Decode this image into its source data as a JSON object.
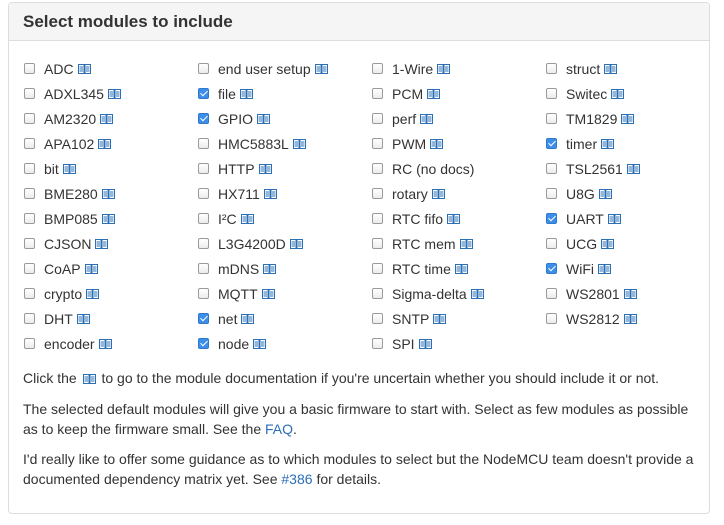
{
  "panel": {
    "title": "Select modules to include"
  },
  "icons": {
    "doc": "book-icon"
  },
  "modules": [
    {
      "name": "ADC",
      "checked": false
    },
    {
      "name": "ADXL345",
      "checked": false
    },
    {
      "name": "AM2320",
      "checked": false
    },
    {
      "name": "APA102",
      "checked": false
    },
    {
      "name": "bit",
      "checked": false
    },
    {
      "name": "BME280",
      "checked": false
    },
    {
      "name": "BMP085",
      "checked": false
    },
    {
      "name": "CJSON",
      "checked": false
    },
    {
      "name": "CoAP",
      "checked": false
    },
    {
      "name": "crypto",
      "checked": false
    },
    {
      "name": "DHT",
      "checked": false
    },
    {
      "name": "encoder",
      "checked": false
    },
    {
      "name": "end user setup",
      "checked": false
    },
    {
      "name": "file",
      "checked": true
    },
    {
      "name": "GPIO",
      "checked": true
    },
    {
      "name": "HMC5883L",
      "checked": false
    },
    {
      "name": "HTTP",
      "checked": false
    },
    {
      "name": "HX711",
      "checked": false
    },
    {
      "name": "I²C",
      "checked": false
    },
    {
      "name": "L3G4200D",
      "checked": false
    },
    {
      "name": "mDNS",
      "checked": false
    },
    {
      "name": "MQTT",
      "checked": false
    },
    {
      "name": "net",
      "checked": true
    },
    {
      "name": "node",
      "checked": true
    },
    {
      "name": "1-Wire",
      "checked": false
    },
    {
      "name": "PCM",
      "checked": false
    },
    {
      "name": "perf",
      "checked": false
    },
    {
      "name": "PWM",
      "checked": false
    },
    {
      "name": "RC (no docs)",
      "checked": false,
      "nodoc": true
    },
    {
      "name": "rotary",
      "checked": false
    },
    {
      "name": "RTC fifo",
      "checked": false
    },
    {
      "name": "RTC mem",
      "checked": false
    },
    {
      "name": "RTC time",
      "checked": false
    },
    {
      "name": "Sigma-delta",
      "checked": false
    },
    {
      "name": "SNTP",
      "checked": false
    },
    {
      "name": "SPI",
      "checked": false
    },
    {
      "name": "struct",
      "checked": false
    },
    {
      "name": "Switec",
      "checked": false
    },
    {
      "name": "TM1829",
      "checked": false
    },
    {
      "name": "timer",
      "checked": true
    },
    {
      "name": "TSL2561",
      "checked": false
    },
    {
      "name": "U8G",
      "checked": false
    },
    {
      "name": "UART",
      "checked": true
    },
    {
      "name": "UCG",
      "checked": false
    },
    {
      "name": "WiFi",
      "checked": true
    },
    {
      "name": "WS2801",
      "checked": false
    },
    {
      "name": "WS2812",
      "checked": false
    }
  ],
  "info": {
    "p1_before": "Click the",
    "p1_after": "to go to the module documentation if you're uncertain whether you should include it or not.",
    "p2_before": "The selected default modules will give you a basic firmware to start with. Select as few modules as possible as to keep the firmware small. See the",
    "p2_link": "FAQ",
    "p2_after": ".",
    "p3_before": "I'd really like to offer some guidance as to which modules to select but the NodeMCU team doesn't provide a documented dependency matrix yet. See",
    "p3_link": "#386",
    "p3_after": "for details."
  }
}
